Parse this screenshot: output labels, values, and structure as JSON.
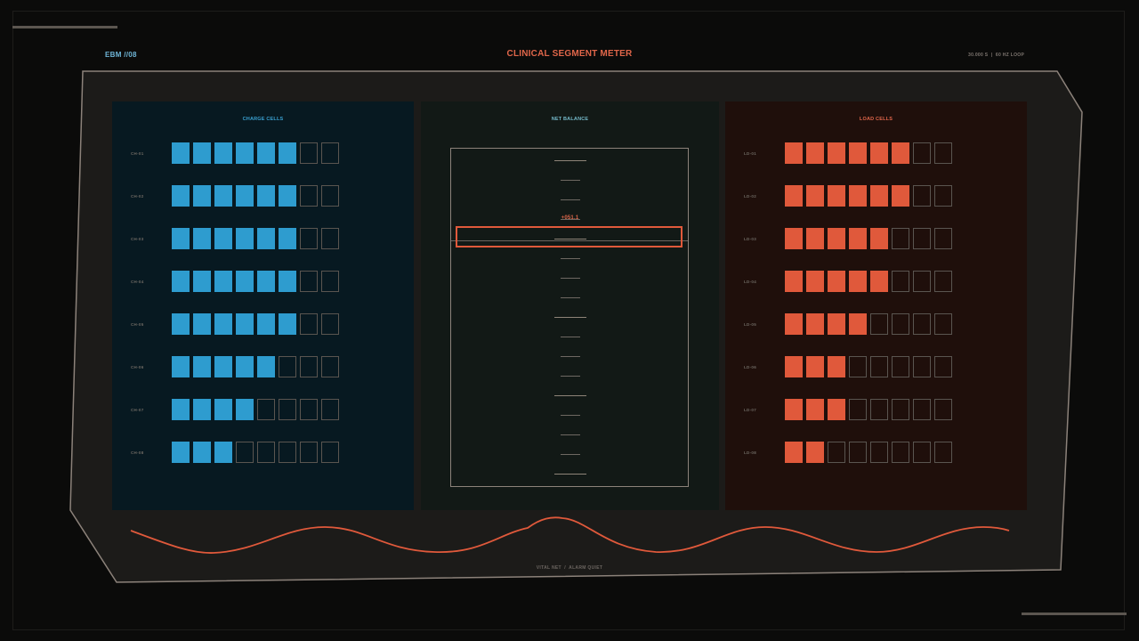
{
  "header": {
    "device_id": "EBM //08",
    "title": "CLINICAL SEGMENT METER",
    "time_readout": "30.000 S",
    "loop_rate": "60 HZ LOOP"
  },
  "colors": {
    "charge": "#2e9ccf",
    "load": "#e0593b",
    "frame": "#8c827a",
    "background": "#0b0b0a"
  },
  "charge_panel": {
    "title": "CHARGE CELLS",
    "cells_per_row": 8,
    "rows": [
      {
        "label": "CH-01",
        "filled": 6
      },
      {
        "label": "CH-02",
        "filled": 6
      },
      {
        "label": "CH-03",
        "filled": 6
      },
      {
        "label": "CH-04",
        "filled": 6
      },
      {
        "label": "CH-05",
        "filled": 6
      },
      {
        "label": "CH-06",
        "filled": 5
      },
      {
        "label": "CH-07",
        "filled": 4
      },
      {
        "label": "CH-08",
        "filled": 3
      }
    ]
  },
  "net_panel": {
    "title": "NET BALANCE",
    "readout": "+051.1",
    "tick_count": 17
  },
  "load_panel": {
    "title": "LOAD CELLS",
    "cells_per_row": 8,
    "rows": [
      {
        "label": "LD-01",
        "filled": 6
      },
      {
        "label": "LD-02",
        "filled": 6
      },
      {
        "label": "LD-03",
        "filled": 5
      },
      {
        "label": "LD-04",
        "filled": 5
      },
      {
        "label": "LD-05",
        "filled": 4
      },
      {
        "label": "LD-06",
        "filled": 3
      },
      {
        "label": "LD-07",
        "filled": 3
      },
      {
        "label": "LD-08",
        "filled": 2
      }
    ]
  },
  "footer": {
    "vital": "VITAL NET",
    "alarm": "ALARM QUIET"
  }
}
